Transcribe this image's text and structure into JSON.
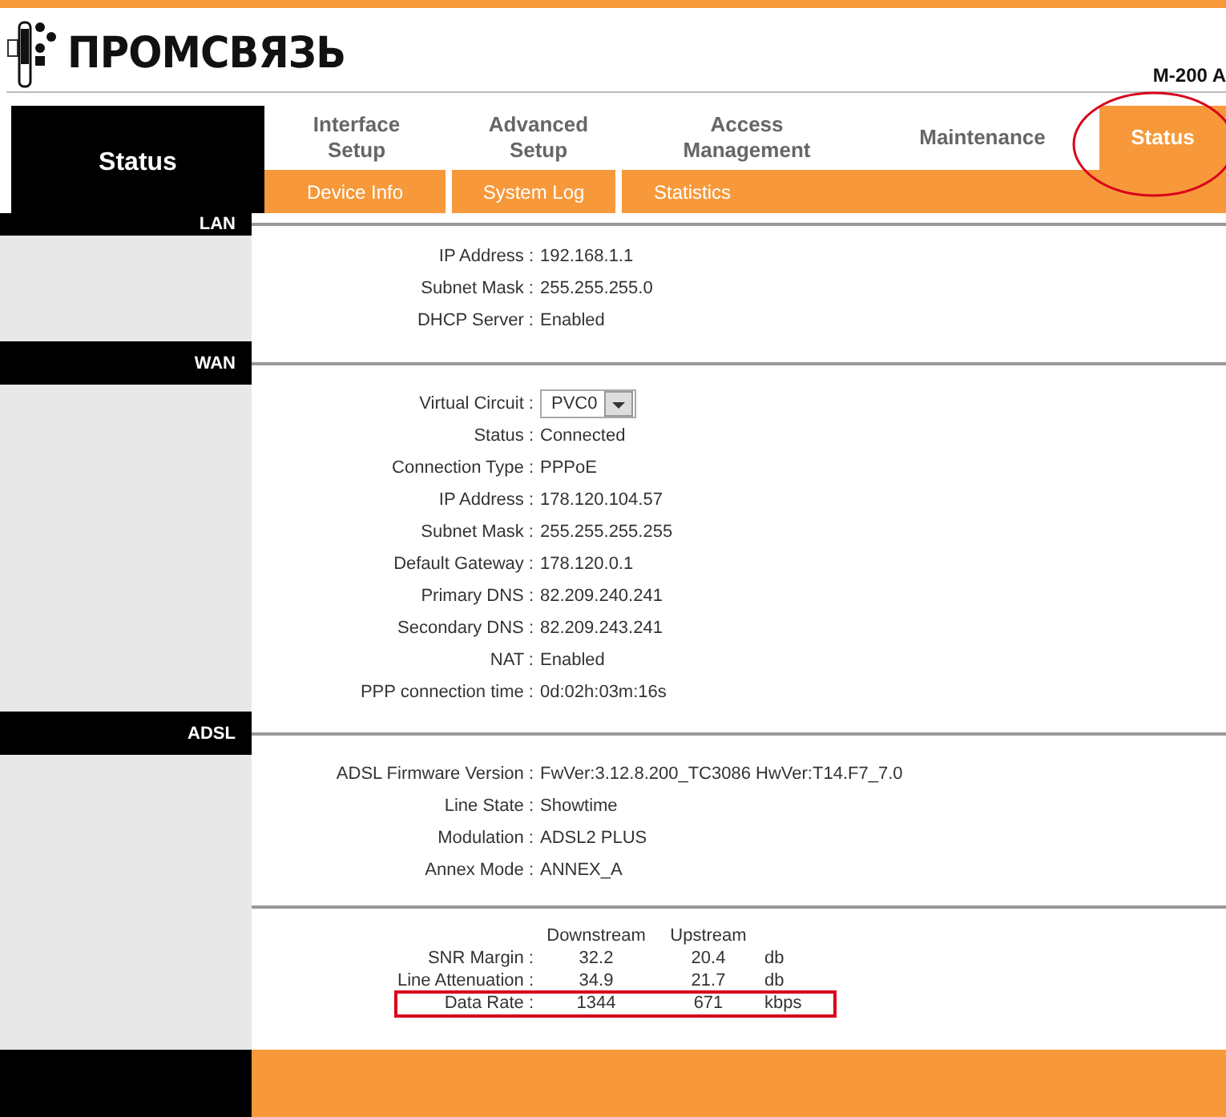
{
  "logo": {
    "text": "ПРОМСВЯЗЬ"
  },
  "model": "M-200 A",
  "nav": {
    "title": "Status",
    "tabs": [
      {
        "label": "Interface Setup",
        "selected": false,
        "circled": false
      },
      {
        "label": "Advanced Setup",
        "selected": false,
        "circled": false
      },
      {
        "label": "Access Management",
        "selected": false,
        "circled": false
      },
      {
        "label": "Maintenance",
        "selected": false,
        "circled": false
      },
      {
        "label": "Status",
        "selected": true,
        "circled": true
      }
    ],
    "subtabs": [
      {
        "label": "Device Info"
      },
      {
        "label": "System Log"
      },
      {
        "label": "Statistics"
      }
    ]
  },
  "sections": [
    {
      "title": "LAN",
      "fields": [
        {
          "kind": "text",
          "label": "IP Address :",
          "value": "192.168.1.1"
        },
        {
          "kind": "text",
          "label": "Subnet Mask :",
          "value": "255.255.255.0"
        },
        {
          "kind": "text",
          "label": "DHCP Server :",
          "value": "Enabled"
        }
      ]
    },
    {
      "title": "WAN",
      "fields": [
        {
          "kind": "select",
          "label": "Virtual Circuit :",
          "value": "PVC0"
        },
        {
          "kind": "text",
          "label": "Status :",
          "value": "Connected"
        },
        {
          "kind": "text",
          "label": "Connection Type :",
          "value": "PPPoE"
        },
        {
          "kind": "text",
          "label": "IP Address :",
          "value": "178.120.104.57"
        },
        {
          "kind": "text",
          "label": "Subnet Mask :",
          "value": "255.255.255.255"
        },
        {
          "kind": "text",
          "label": "Default Gateway :",
          "value": "178.120.0.1"
        },
        {
          "kind": "text",
          "label": "Primary DNS :",
          "value": "82.209.240.241"
        },
        {
          "kind": "text",
          "label": "Secondary DNS :",
          "value": "82.209.243.241"
        },
        {
          "kind": "text",
          "label": "NAT :",
          "value": "Enabled"
        },
        {
          "kind": "text",
          "label": "PPP connection time :",
          "value": "0d:02h:03m:16s"
        }
      ]
    },
    {
      "title": "ADSL",
      "fields": [
        {
          "kind": "text",
          "label": "ADSL Firmware Version :",
          "value": "FwVer:3.12.8.200_TC3086 HwVer:T14.F7_7.0"
        },
        {
          "kind": "text",
          "label": "Line State :",
          "value": "Showtime"
        },
        {
          "kind": "text",
          "label": "Modulation :",
          "value": "ADSL2 PLUS"
        },
        {
          "kind": "text",
          "label": "Annex Mode :",
          "value": "ANNEX_A"
        }
      ],
      "stats": {
        "columns": [
          "Downstream",
          "Upstream"
        ],
        "rows": [
          {
            "label": "SNR Margin :",
            "downstream": "32.2",
            "upstream": "20.4",
            "unit": "db",
            "highlighted": false
          },
          {
            "label": "Line Attenuation :",
            "downstream": "34.9",
            "upstream": "21.7",
            "unit": "db",
            "highlighted": false
          },
          {
            "label": "Data Rate :",
            "downstream": "1344",
            "upstream": "671",
            "unit": "kbps",
            "highlighted": true
          }
        ]
      }
    }
  ]
}
